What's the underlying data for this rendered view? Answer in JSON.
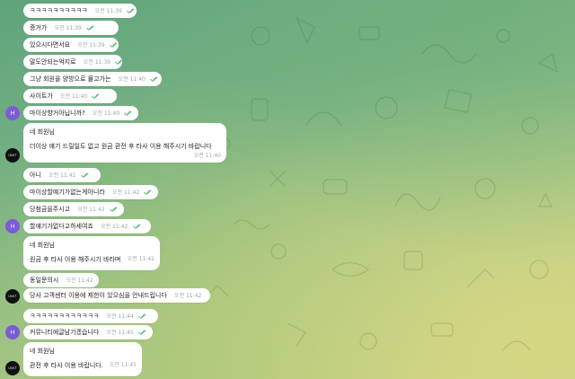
{
  "avatars": {
    "h_letter": "H",
    "logo_text": "UNIT"
  },
  "messages": [
    {
      "text": "ㅋㅋㅋㅋㅋㅋㅋㅋㅋㅋ",
      "time": "오전 11:39"
    },
    {
      "text": "증거가",
      "time": "오전 11:39"
    },
    {
      "text": "있으시다면서요",
      "time": "오전 11:39"
    },
    {
      "text": "말도안되는억지로",
      "time": "오전 11:39"
    },
    {
      "text": "그냥 회원을 양방으로 몰고가는",
      "time": "오전 11:40"
    },
    {
      "text": "사이트가",
      "time": "오전 11:40"
    },
    {
      "text": "마이상향거아닙니까?",
      "time": "오전 11:40"
    },
    {
      "lines": [
        "네 회원님",
        "더이상 얘기 드릴일도 없고 원금 환전 후 타사 이용 해주시기 바랍니다"
      ],
      "time": "오전 11:40"
    },
    {
      "text": "아니",
      "time": "오전 11:41"
    },
    {
      "text": "마이상할얘기가없는게아니라",
      "time": "오전 11:42"
    },
    {
      "text": "당첨금을주시고",
      "time": "오전 11:42"
    },
    {
      "text": "할얘기가없다고하세여죠",
      "time": "오전 11:42"
    },
    {
      "lines": [
        "네 회원님",
        "원금 후 타사 이용 해주시기 바라며"
      ],
      "time": "오전 11:42"
    },
    {
      "text": "동일문의시",
      "time": "오전 11:42"
    },
    {
      "text": "당사 고객센터 이용에 제한이 있으심을 안내드립니다",
      "time": "오전 11:42"
    },
    {
      "text": "ㅋㅋㅋㅋㅋㅋㅋㅋㅋㅋㅋㅋ",
      "time": "오전 11:44"
    },
    {
      "text": "커뮤니티에글남기겠습니다",
      "time": "오전 11:45"
    },
    {
      "lines": [
        "네 회원님",
        "환전 후 타사 이용 바랍니다."
      ],
      "time": "오전 11:45"
    }
  ],
  "colors": {
    "bubble": "#ffffff",
    "check": "#5dbb72",
    "time": "#9aa6a6"
  }
}
